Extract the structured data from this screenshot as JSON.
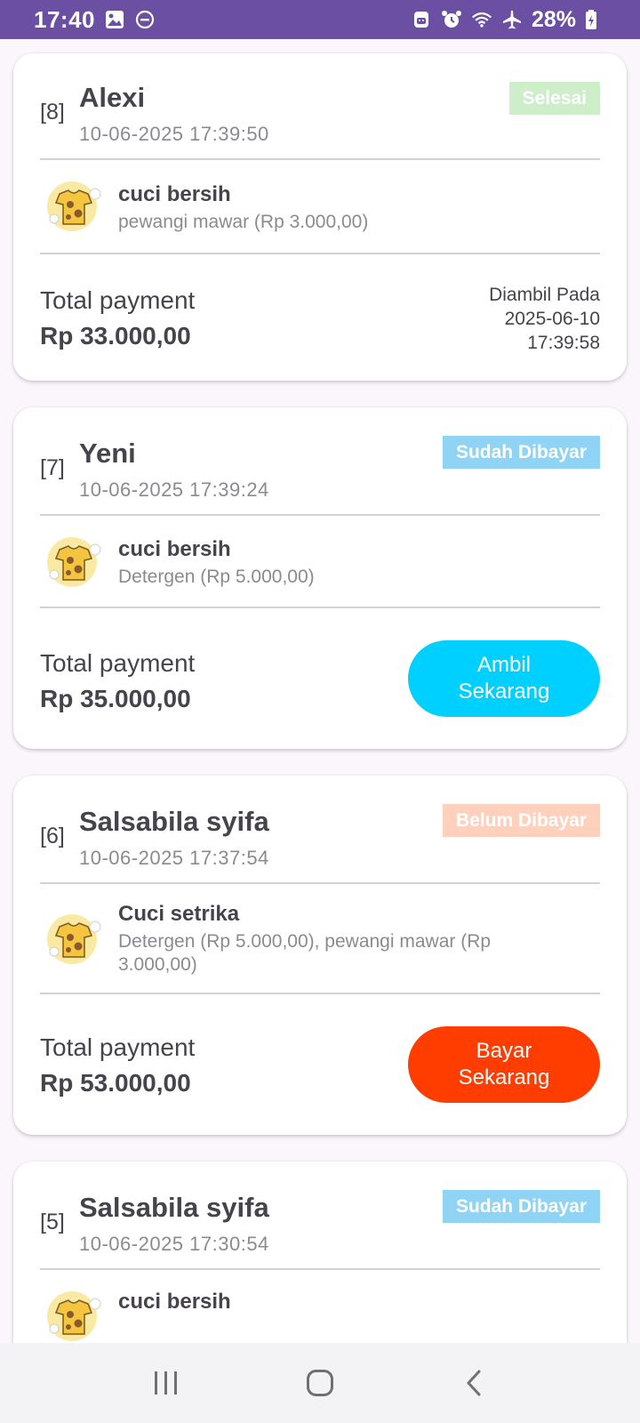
{
  "status_bar": {
    "time": "17:40",
    "battery": "28%",
    "icons_left": [
      "image-icon",
      "do-not-disturb-icon"
    ],
    "icons_right": [
      "android-icon",
      "alarm-icon",
      "wifi-icon",
      "airplane-icon",
      "battery-charging-icon"
    ]
  },
  "orders": [
    {
      "number": "[8]",
      "customer": "Alexi",
      "datetime": "10-06-2025  17:39:50",
      "status": "Selesai",
      "status_color": "#cdeec9",
      "service": "cuci bersih",
      "extras": "pewangi mawar (Rp 3.000,00)",
      "total_label": "Total payment",
      "total": "Rp 33.000,00",
      "picked_up": {
        "label": "Diambil Pada",
        "date": "2025-06-10",
        "time": "17:39:58"
      }
    },
    {
      "number": "[7]",
      "customer": "Yeni",
      "datetime": "10-06-2025  17:39:24",
      "status": "Sudah Dibayar",
      "status_color": "#8fd3f5",
      "service": "cuci bersih",
      "extras": "Detergen (Rp 5.000,00)",
      "total_label": "Total payment",
      "total": "Rp 35.000,00",
      "action": {
        "line1": "Ambil",
        "line2": "Sekarang",
        "color": "#00d0ff"
      }
    },
    {
      "number": "[6]",
      "customer": "Salsabila syifa",
      "datetime": "10-06-2025  17:37:54",
      "status": "Belum Dibayar",
      "status_color": "#ffd1bd",
      "service": "Cuci setrika",
      "extras": "Detergen (Rp 5.000,00), pewangi mawar (Rp 3.000,00)",
      "total_label": "Total payment",
      "total": "Rp 53.000,00",
      "action": {
        "line1": "Bayar",
        "line2": "Sekarang",
        "color": "#ff3d00"
      }
    },
    {
      "number": "[5]",
      "customer": "Salsabila syifa",
      "datetime": "10-06-2025  17:30:54",
      "status": "Sudah Dibayar",
      "status_color": "#8fd3f5",
      "service": "cuci bersih"
    }
  ],
  "nav_bar": {
    "buttons": [
      "recent-apps-icon",
      "home-icon",
      "back-icon"
    ]
  }
}
